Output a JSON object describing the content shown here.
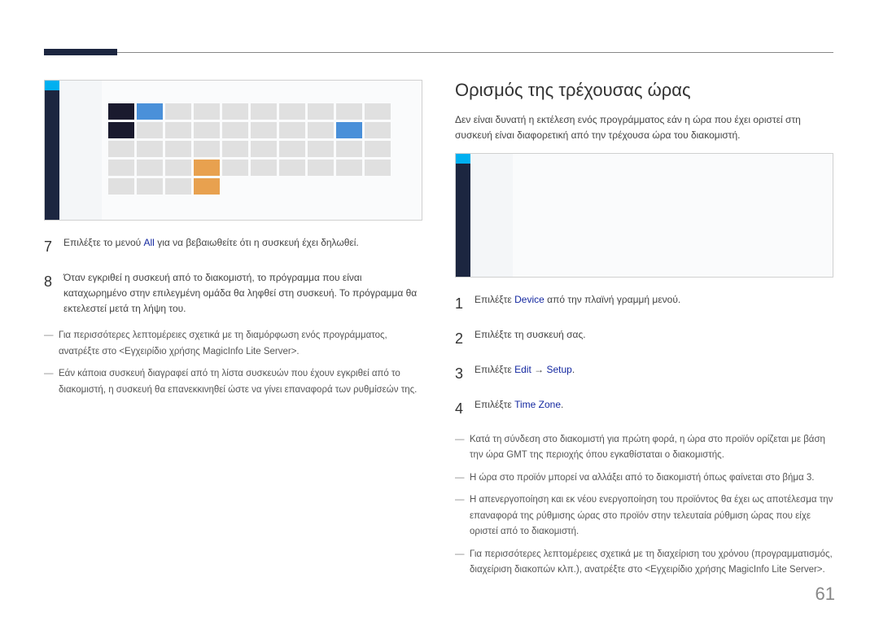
{
  "left": {
    "step7_num": "7",
    "step7_pre": "Επιλέξτε το μενού ",
    "step7_link": "All",
    "step7_post": " για να βεβαιωθείτε ότι η συσκευή έχει δηλωθεί.",
    "step8_num": "8",
    "step8_text": "Όταν εγκριθεί η συσκευή από το διακομιστή, το πρόγραμμα που είναι καταχωρημένο στην επιλεγμένη ομάδα θα ληφθεί στη συσκευή. Το πρόγραμμα θα εκτελεστεί μετά τη λήψη του.",
    "note1": "Για περισσότερες λεπτομέρειες σχετικά με τη διαμόρφωση ενός προγράμματος, ανατρέξτε στο <Εγχειρίδιο χρήσης MagicInfo Lite Server>.",
    "note2": "Εάν κάποια συσκευή διαγραφεί από τη λίστα συσκευών που έχουν εγκριθεί από το διακομιστή, η συσκευή θα επανεκκινηθεί ώστε να γίνει επαναφορά των ρυθμίσεών της."
  },
  "right": {
    "title": "Ορισμός της τρέχουσας ώρας",
    "intro": "Δεν είναι δυνατή η εκτέλεση ενός προγράμματος εάν η ώρα που έχει οριστεί στη συσκευή είναι διαφορετική από την τρέχουσα ώρα του διακομιστή.",
    "step1_num": "1",
    "step1_pre": "Επιλέξτε ",
    "step1_link": "Device",
    "step1_post": " από την πλαϊνή γραμμή μενού.",
    "step2_num": "2",
    "step2_text": "Επιλέξτε τη συσκευή σας.",
    "step3_num": "3",
    "step3_pre": "Επιλέξτε ",
    "step3_link1": "Edit",
    "step3_arrow": " → ",
    "step3_link2": "Setup",
    "step3_post": ".",
    "step4_num": "4",
    "step4_pre": "Επιλέξτε ",
    "step4_link": "Time Zone",
    "step4_post": ".",
    "note1": "Κατά τη σύνδεση στο διακομιστή για πρώτη φορά, η ώρα στο προϊόν ορίζεται με βάση την ώρα GMT της περιοχής όπου εγκαθίσταται ο διακομιστής.",
    "note2": "Η ώρα στο προϊόν μπορεί να αλλάξει από το διακομιστή όπως φαίνεται στο βήμα 3.",
    "note3": "Η απενεργοποίηση και εκ νέου ενεργοποίηση του προϊόντος θα έχει ως αποτέλεσμα την επαναφορά της ρύθμισης ώρας στο προϊόν στην τελευταία ρύθμιση ώρας που είχε οριστεί από το διακομιστή.",
    "note4": "Για περισσότερες λεπτομέρειες σχετικά με τη διαχείριση του χρόνου (προγραμματισμός, διαχείριση διακοπών κλπ.), ανατρέξτε στο <Εγχειρίδιο χρήσης MagicInfo Lite Server>."
  },
  "page_number": "61"
}
